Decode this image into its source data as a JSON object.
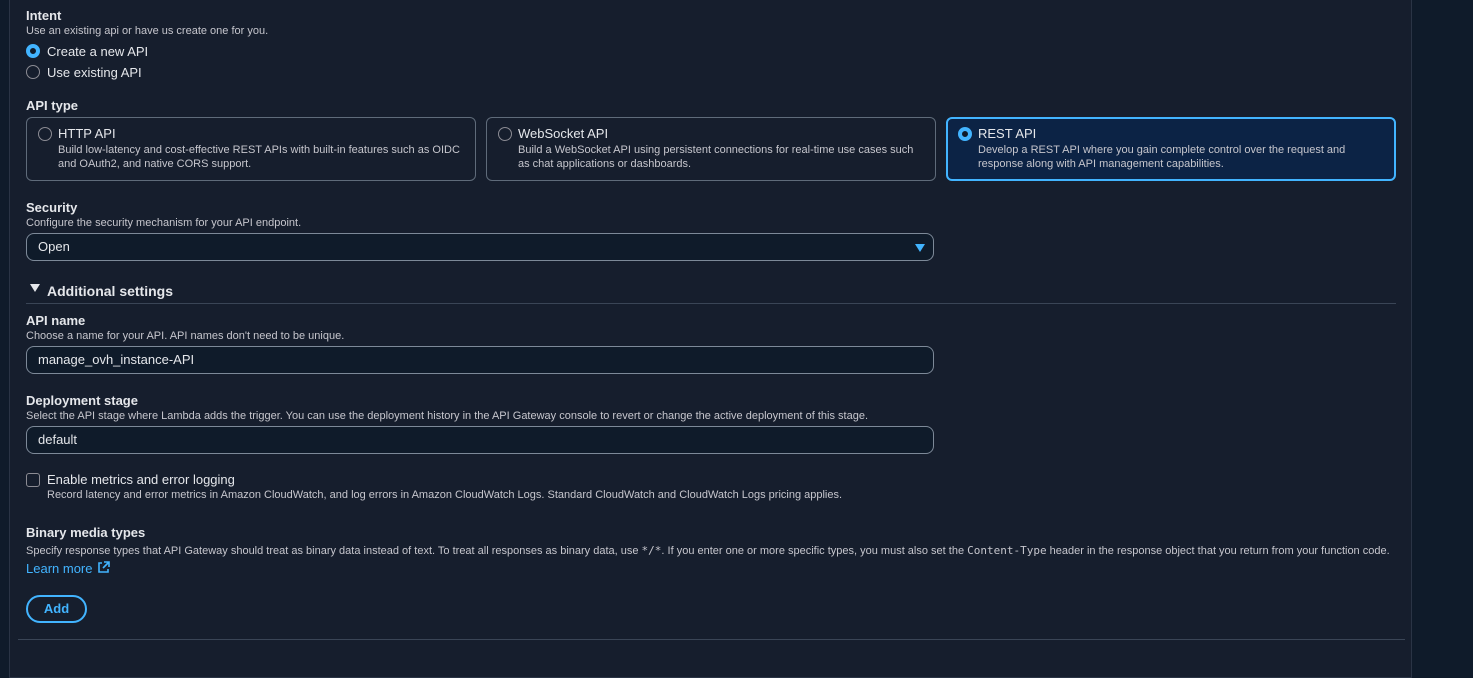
{
  "intent": {
    "label": "Intent",
    "description": "Use an existing api or have us create one for you.",
    "options": [
      {
        "label": "Create a new API",
        "selected": true
      },
      {
        "label": "Use existing API",
        "selected": false
      }
    ]
  },
  "api_type": {
    "label": "API type",
    "tiles": [
      {
        "title": "HTTP API",
        "description": "Build low-latency and cost-effective REST APIs with built-in features such as OIDC and OAuth2, and native CORS support.",
        "selected": false
      },
      {
        "title": "WebSocket API",
        "description": "Build a WebSocket API using persistent connections for real-time use cases such as chat applications or dashboards.",
        "selected": false
      },
      {
        "title": "REST API",
        "description": "Develop a REST API where you gain complete control over the request and response along with API management capabilities.",
        "selected": true
      }
    ]
  },
  "security": {
    "label": "Security",
    "description": "Configure the security mechanism for your API endpoint.",
    "value": "Open"
  },
  "additional_settings": {
    "label": "Additional settings"
  },
  "api_name": {
    "label": "API name",
    "description": "Choose a name for your API. API names don't need to be unique.",
    "value": "manage_ovh_instance-API"
  },
  "deployment_stage": {
    "label": "Deployment stage",
    "description": "Select the API stage where Lambda adds the trigger. You can use the deployment history in the API Gateway console to revert or change the active deployment of this stage.",
    "value": "default"
  },
  "metrics": {
    "label": "Enable metrics and error logging",
    "description": "Record latency and error metrics in Amazon CloudWatch, and log errors in Amazon CloudWatch Logs. Standard CloudWatch and CloudWatch Logs pricing applies.",
    "checked": false
  },
  "binary_media": {
    "label": "Binary media types",
    "desc_part1": "Specify response types that API Gateway should treat as binary data instead of text. To treat all responses as binary data, use ",
    "code1": "*/*",
    "desc_part2": ". If you enter one or more specific types, you must also set the ",
    "code2": "Content-Type",
    "desc_part3": " header in the response object that you return from your function code. ",
    "link_part1": "Learn",
    "link_part2": "more",
    "add_label": "Add"
  },
  "colors": {
    "accent": "#42b4ff",
    "background": "#161e2d",
    "selected_tile": "#0c2345"
  }
}
